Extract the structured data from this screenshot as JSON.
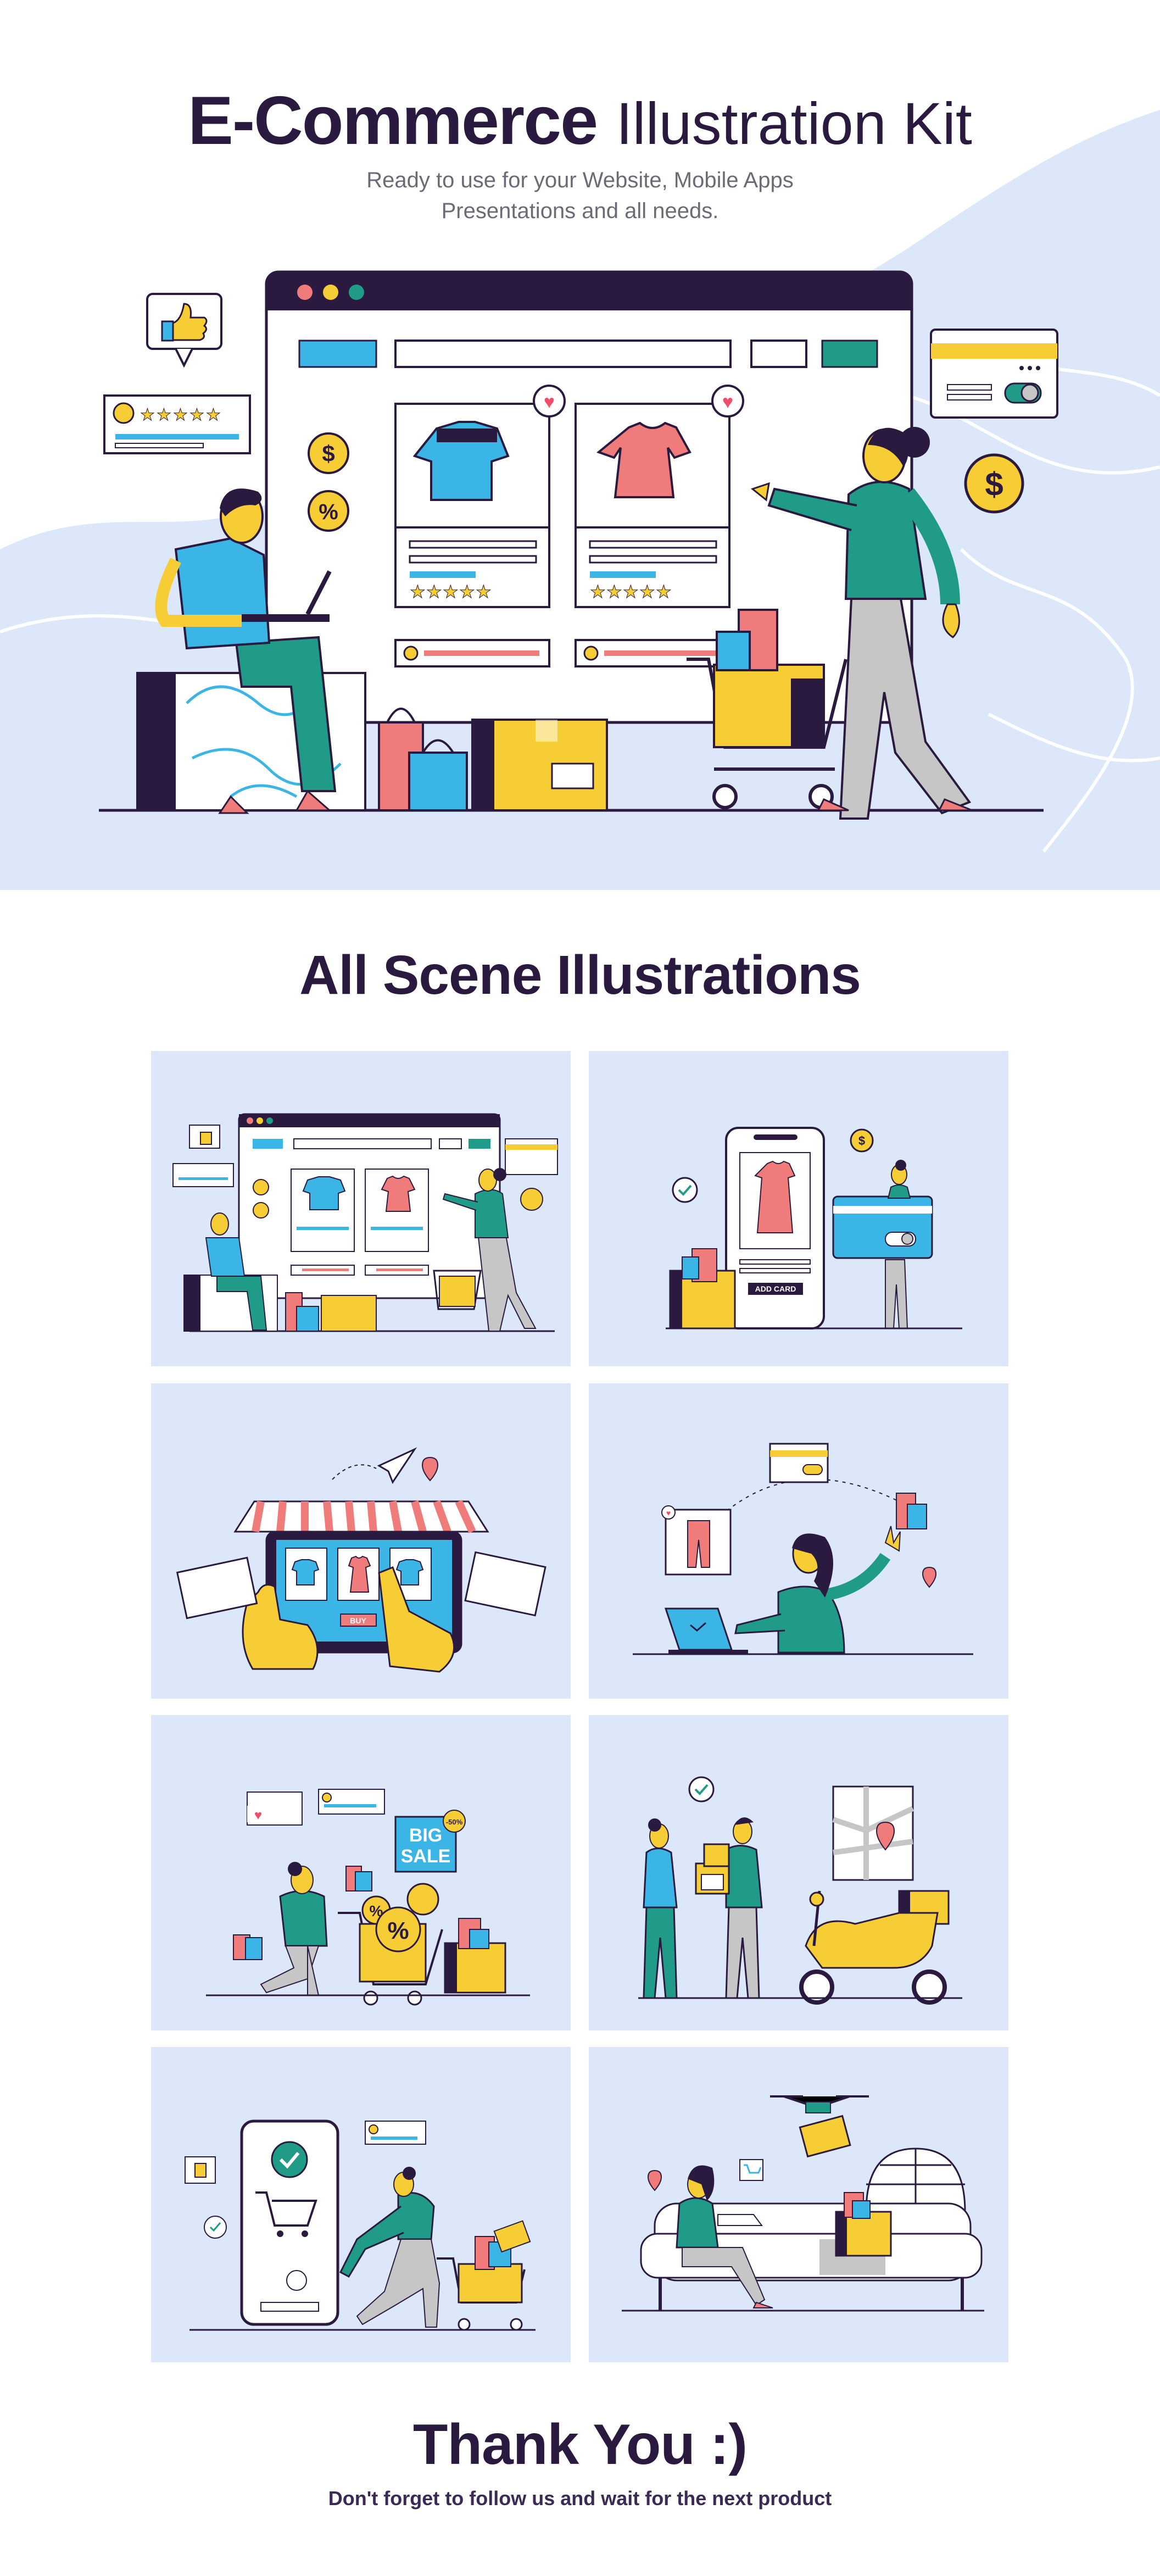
{
  "hero": {
    "title_bold": "E-Commerce",
    "title_light": "Illustration Kit",
    "subtitle_line1": "Ready to use for your Website, Mobile Apps",
    "subtitle_line2": "Presentations and all needs."
  },
  "gallery": {
    "title": "All Scene Illustrations",
    "add_card_label": "ADD CARD",
    "buy_label": "BUY",
    "big_sale_line1": "BIG",
    "big_sale_line2": "SALE",
    "discount_badge": "-50%"
  },
  "footer": {
    "thanks": "Thank You :)",
    "follow_text": "Don't forget to follow us and wait for the next product"
  },
  "glyphs": {
    "dollar": "$",
    "percent": "%",
    "heart": "♥",
    "star": "★"
  },
  "colors": {
    "navy": "#2b1a3f",
    "tile_bg": "#dce8fa",
    "teal": "#1f9b87",
    "blue": "#3bb4e6",
    "yellow": "#f7cd35",
    "pink": "#ef7b7b",
    "grey": "#c6c6c6"
  }
}
